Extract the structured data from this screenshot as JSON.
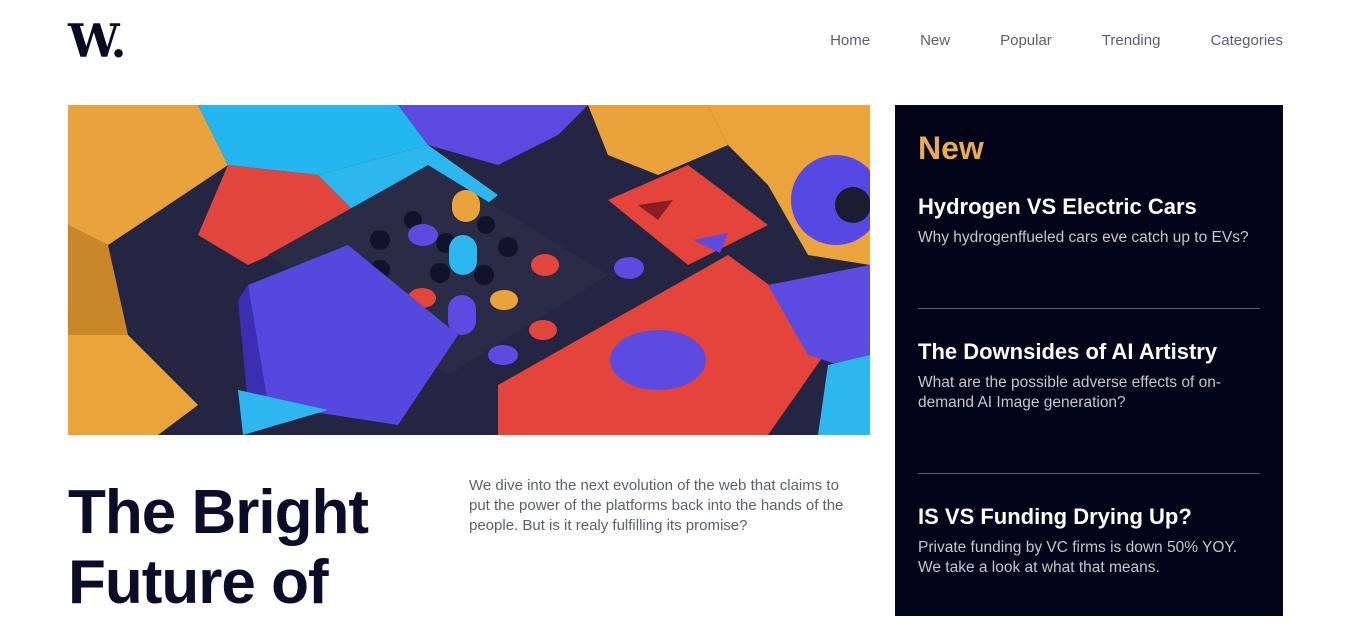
{
  "header": {
    "logo": "W.",
    "nav": [
      {
        "label": "Home"
      },
      {
        "label": "New"
      },
      {
        "label": "Popular"
      },
      {
        "label": "Trending"
      },
      {
        "label": "Categories"
      }
    ]
  },
  "main": {
    "title": "The Bright Future of",
    "intro": "We dive into the next evolution of the web that claims to put the power of the platforms back into the hands of the people. But is it realy fulfilling its promise?"
  },
  "sidebar": {
    "heading": "New",
    "articles": [
      {
        "title": "Hydrogen VS Electric Cars",
        "desc": "Why hydrogenffueled cars eve catch up to EVs?"
      },
      {
        "title": "The Downsides of AI Artistry",
        "desc": "What are the possible adverse effects of on-demand AI Image generation?"
      },
      {
        "title": "IS VS Funding Drying Up?",
        "desc": "Private funding by VC firms is down 50% YOY. We take a look at what that means."
      }
    ]
  },
  "colors": {
    "accent": "#e9ab53",
    "sidebar_bg": "#02041a",
    "text_dark": "#0b0d28",
    "text_muted": "#5d5f6d"
  }
}
